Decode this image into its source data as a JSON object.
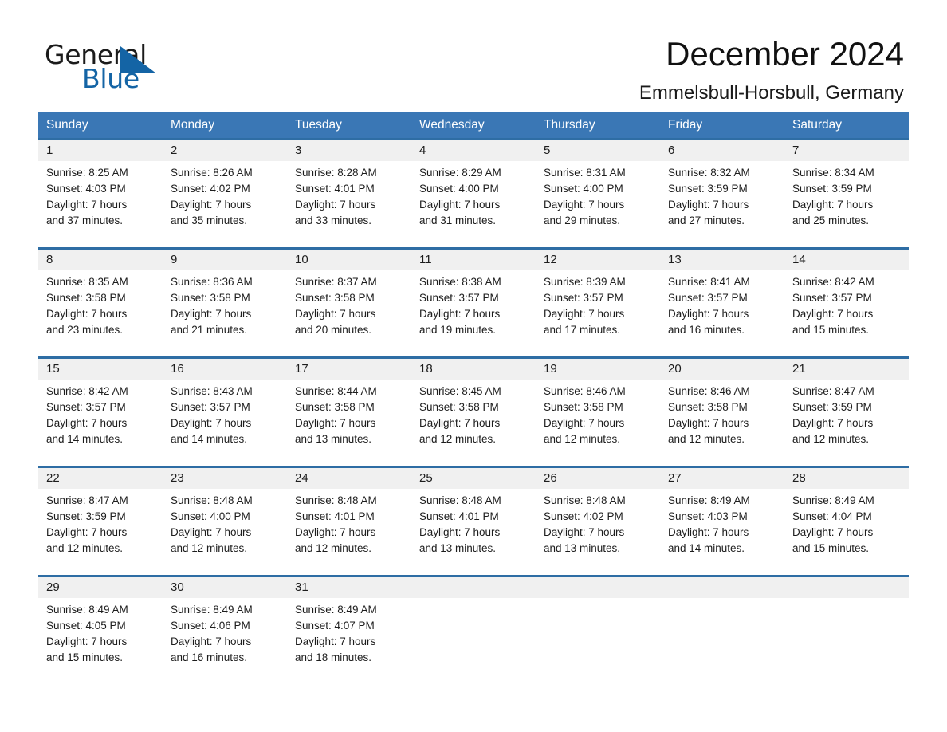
{
  "logo": {
    "word_one": "General",
    "word_two": "Blue",
    "triangle_icon": "triangle-icon",
    "accent_color": "#1464a5"
  },
  "header": {
    "month_title": "December 2024",
    "location": "Emmelsbull-Horsbull, Germany"
  },
  "calendar": {
    "header_bg": "#3a77b5",
    "row_divider_color": "#2e6da4",
    "date_band_bg": "#f0f0f0",
    "weekdays": [
      "Sunday",
      "Monday",
      "Tuesday",
      "Wednesday",
      "Thursday",
      "Friday",
      "Saturday"
    ],
    "weeks": [
      [
        {
          "date": "1",
          "sunrise": "Sunrise: 8:25 AM",
          "sunset": "Sunset: 4:03 PM",
          "daylight_line1": "Daylight: 7 hours",
          "daylight_line2": "and 37 minutes."
        },
        {
          "date": "2",
          "sunrise": "Sunrise: 8:26 AM",
          "sunset": "Sunset: 4:02 PM",
          "daylight_line1": "Daylight: 7 hours",
          "daylight_line2": "and 35 minutes."
        },
        {
          "date": "3",
          "sunrise": "Sunrise: 8:28 AM",
          "sunset": "Sunset: 4:01 PM",
          "daylight_line1": "Daylight: 7 hours",
          "daylight_line2": "and 33 minutes."
        },
        {
          "date": "4",
          "sunrise": "Sunrise: 8:29 AM",
          "sunset": "Sunset: 4:00 PM",
          "daylight_line1": "Daylight: 7 hours",
          "daylight_line2": "and 31 minutes."
        },
        {
          "date": "5",
          "sunrise": "Sunrise: 8:31 AM",
          "sunset": "Sunset: 4:00 PM",
          "daylight_line1": "Daylight: 7 hours",
          "daylight_line2": "and 29 minutes."
        },
        {
          "date": "6",
          "sunrise": "Sunrise: 8:32 AM",
          "sunset": "Sunset: 3:59 PM",
          "daylight_line1": "Daylight: 7 hours",
          "daylight_line2": "and 27 minutes."
        },
        {
          "date": "7",
          "sunrise": "Sunrise: 8:34 AM",
          "sunset": "Sunset: 3:59 PM",
          "daylight_line1": "Daylight: 7 hours",
          "daylight_line2": "and 25 minutes."
        }
      ],
      [
        {
          "date": "8",
          "sunrise": "Sunrise: 8:35 AM",
          "sunset": "Sunset: 3:58 PM",
          "daylight_line1": "Daylight: 7 hours",
          "daylight_line2": "and 23 minutes."
        },
        {
          "date": "9",
          "sunrise": "Sunrise: 8:36 AM",
          "sunset": "Sunset: 3:58 PM",
          "daylight_line1": "Daylight: 7 hours",
          "daylight_line2": "and 21 minutes."
        },
        {
          "date": "10",
          "sunrise": "Sunrise: 8:37 AM",
          "sunset": "Sunset: 3:58 PM",
          "daylight_line1": "Daylight: 7 hours",
          "daylight_line2": "and 20 minutes."
        },
        {
          "date": "11",
          "sunrise": "Sunrise: 8:38 AM",
          "sunset": "Sunset: 3:57 PM",
          "daylight_line1": "Daylight: 7 hours",
          "daylight_line2": "and 19 minutes."
        },
        {
          "date": "12",
          "sunrise": "Sunrise: 8:39 AM",
          "sunset": "Sunset: 3:57 PM",
          "daylight_line1": "Daylight: 7 hours",
          "daylight_line2": "and 17 minutes."
        },
        {
          "date": "13",
          "sunrise": "Sunrise: 8:41 AM",
          "sunset": "Sunset: 3:57 PM",
          "daylight_line1": "Daylight: 7 hours",
          "daylight_line2": "and 16 minutes."
        },
        {
          "date": "14",
          "sunrise": "Sunrise: 8:42 AM",
          "sunset": "Sunset: 3:57 PM",
          "daylight_line1": "Daylight: 7 hours",
          "daylight_line2": "and 15 minutes."
        }
      ],
      [
        {
          "date": "15",
          "sunrise": "Sunrise: 8:42 AM",
          "sunset": "Sunset: 3:57 PM",
          "daylight_line1": "Daylight: 7 hours",
          "daylight_line2": "and 14 minutes."
        },
        {
          "date": "16",
          "sunrise": "Sunrise: 8:43 AM",
          "sunset": "Sunset: 3:57 PM",
          "daylight_line1": "Daylight: 7 hours",
          "daylight_line2": "and 14 minutes."
        },
        {
          "date": "17",
          "sunrise": "Sunrise: 8:44 AM",
          "sunset": "Sunset: 3:58 PM",
          "daylight_line1": "Daylight: 7 hours",
          "daylight_line2": "and 13 minutes."
        },
        {
          "date": "18",
          "sunrise": "Sunrise: 8:45 AM",
          "sunset": "Sunset: 3:58 PM",
          "daylight_line1": "Daylight: 7 hours",
          "daylight_line2": "and 12 minutes."
        },
        {
          "date": "19",
          "sunrise": "Sunrise: 8:46 AM",
          "sunset": "Sunset: 3:58 PM",
          "daylight_line1": "Daylight: 7 hours",
          "daylight_line2": "and 12 minutes."
        },
        {
          "date": "20",
          "sunrise": "Sunrise: 8:46 AM",
          "sunset": "Sunset: 3:58 PM",
          "daylight_line1": "Daylight: 7 hours",
          "daylight_line2": "and 12 minutes."
        },
        {
          "date": "21",
          "sunrise": "Sunrise: 8:47 AM",
          "sunset": "Sunset: 3:59 PM",
          "daylight_line1": "Daylight: 7 hours",
          "daylight_line2": "and 12 minutes."
        }
      ],
      [
        {
          "date": "22",
          "sunrise": "Sunrise: 8:47 AM",
          "sunset": "Sunset: 3:59 PM",
          "daylight_line1": "Daylight: 7 hours",
          "daylight_line2": "and 12 minutes."
        },
        {
          "date": "23",
          "sunrise": "Sunrise: 8:48 AM",
          "sunset": "Sunset: 4:00 PM",
          "daylight_line1": "Daylight: 7 hours",
          "daylight_line2": "and 12 minutes."
        },
        {
          "date": "24",
          "sunrise": "Sunrise: 8:48 AM",
          "sunset": "Sunset: 4:01 PM",
          "daylight_line1": "Daylight: 7 hours",
          "daylight_line2": "and 12 minutes."
        },
        {
          "date": "25",
          "sunrise": "Sunrise: 8:48 AM",
          "sunset": "Sunset: 4:01 PM",
          "daylight_line1": "Daylight: 7 hours",
          "daylight_line2": "and 13 minutes."
        },
        {
          "date": "26",
          "sunrise": "Sunrise: 8:48 AM",
          "sunset": "Sunset: 4:02 PM",
          "daylight_line1": "Daylight: 7 hours",
          "daylight_line2": "and 13 minutes."
        },
        {
          "date": "27",
          "sunrise": "Sunrise: 8:49 AM",
          "sunset": "Sunset: 4:03 PM",
          "daylight_line1": "Daylight: 7 hours",
          "daylight_line2": "and 14 minutes."
        },
        {
          "date": "28",
          "sunrise": "Sunrise: 8:49 AM",
          "sunset": "Sunset: 4:04 PM",
          "daylight_line1": "Daylight: 7 hours",
          "daylight_line2": "and 15 minutes."
        }
      ],
      [
        {
          "date": "29",
          "sunrise": "Sunrise: 8:49 AM",
          "sunset": "Sunset: 4:05 PM",
          "daylight_line1": "Daylight: 7 hours",
          "daylight_line2": "and 15 minutes."
        },
        {
          "date": "30",
          "sunrise": "Sunrise: 8:49 AM",
          "sunset": "Sunset: 4:06 PM",
          "daylight_line1": "Daylight: 7 hours",
          "daylight_line2": "and 16 minutes."
        },
        {
          "date": "31",
          "sunrise": "Sunrise: 8:49 AM",
          "sunset": "Sunset: 4:07 PM",
          "daylight_line1": "Daylight: 7 hours",
          "daylight_line2": "and 18 minutes."
        },
        {
          "date": "",
          "sunrise": "",
          "sunset": "",
          "daylight_line1": "",
          "daylight_line2": ""
        },
        {
          "date": "",
          "sunrise": "",
          "sunset": "",
          "daylight_line1": "",
          "daylight_line2": ""
        },
        {
          "date": "",
          "sunrise": "",
          "sunset": "",
          "daylight_line1": "",
          "daylight_line2": ""
        },
        {
          "date": "",
          "sunrise": "",
          "sunset": "",
          "daylight_line1": "",
          "daylight_line2": ""
        }
      ]
    ]
  }
}
